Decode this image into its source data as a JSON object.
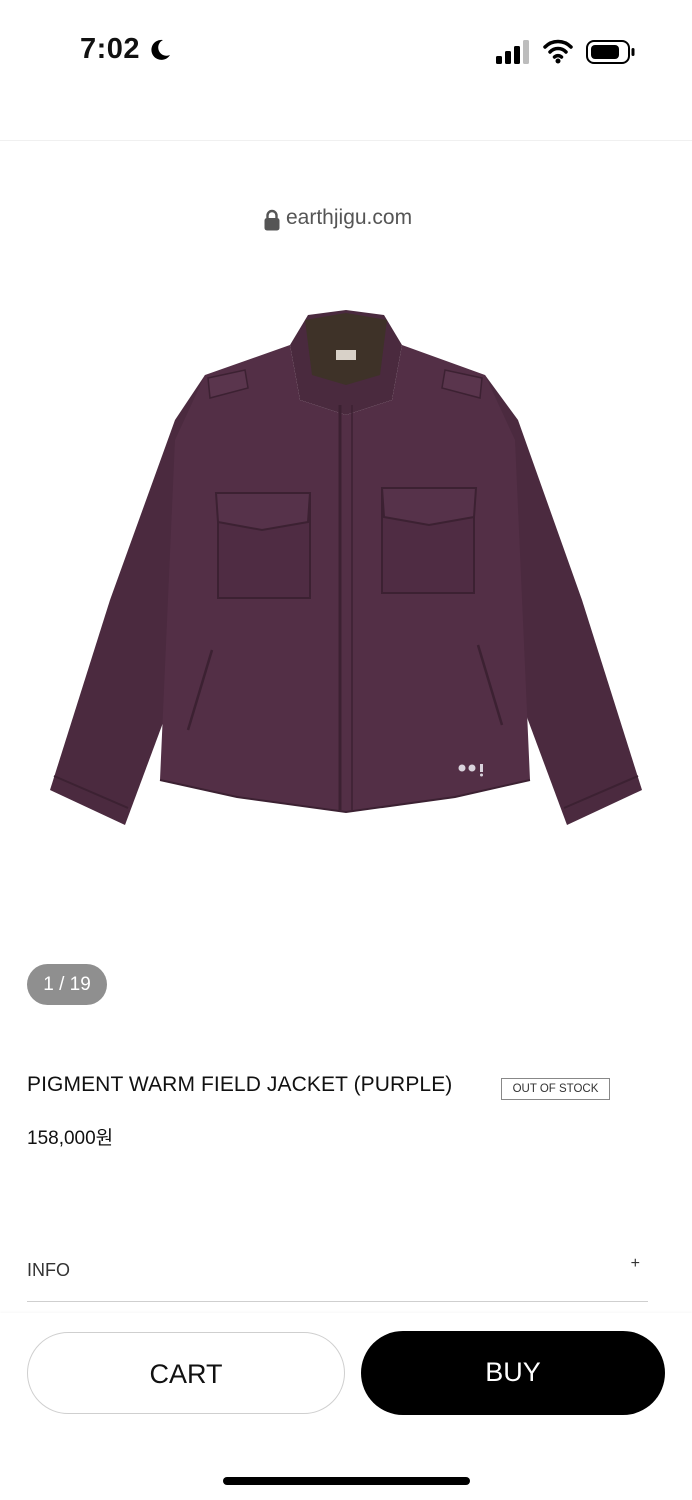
{
  "status_bar": {
    "time": "7:02",
    "icons": [
      "moon-icon",
      "cellular-signal-icon",
      "wifi-icon",
      "battery-icon"
    ]
  },
  "browser": {
    "url": "earthjigu.com",
    "lock_icon": "lock-icon"
  },
  "product": {
    "image_alt": "purple field jacket",
    "image_color": "#4b2a3f",
    "slide_counter": "1 / 19",
    "title": "PIGMENT WARM FIELD JACKET (PURPLE)",
    "stock_badge": "OUT OF STOCK",
    "price": "158,000원"
  },
  "accordion": {
    "info_label": "INFO",
    "expand_symbol": "+"
  },
  "actions": {
    "cart_label": "CART",
    "buy_label": "BUY"
  },
  "colors": {
    "accent": "#000000",
    "counter_bg": "#8f8f8f",
    "jacket": "#4b2a3f"
  }
}
